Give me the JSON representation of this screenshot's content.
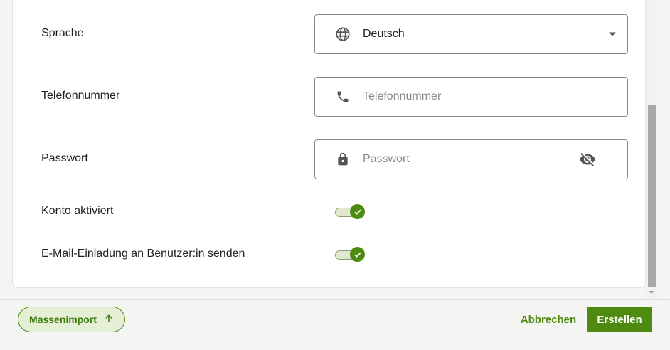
{
  "form": {
    "language": {
      "label": "Sprache",
      "value": "Deutsch",
      "icon": "globe-icon"
    },
    "phone": {
      "label": "Telefonnummer",
      "placeholder": "Telefonnummer",
      "icon": "phone-icon"
    },
    "password": {
      "label": "Passwort",
      "placeholder": "Passwort",
      "icon": "lock-icon",
      "toggle_icon": "eye-off-icon"
    },
    "account_active": {
      "label": "Konto aktiviert",
      "checked": true
    },
    "email_invite": {
      "label": "E-Mail-Einladung an Benutzer:in senden",
      "checked": true
    }
  },
  "footer": {
    "import_label": "Massenimport",
    "cancel_label": "Abbrechen",
    "create_label": "Erstellen"
  },
  "colors": {
    "accent": "#4d8a0f",
    "accent_light": "#e4efd6",
    "border": "#8a8a8a"
  }
}
